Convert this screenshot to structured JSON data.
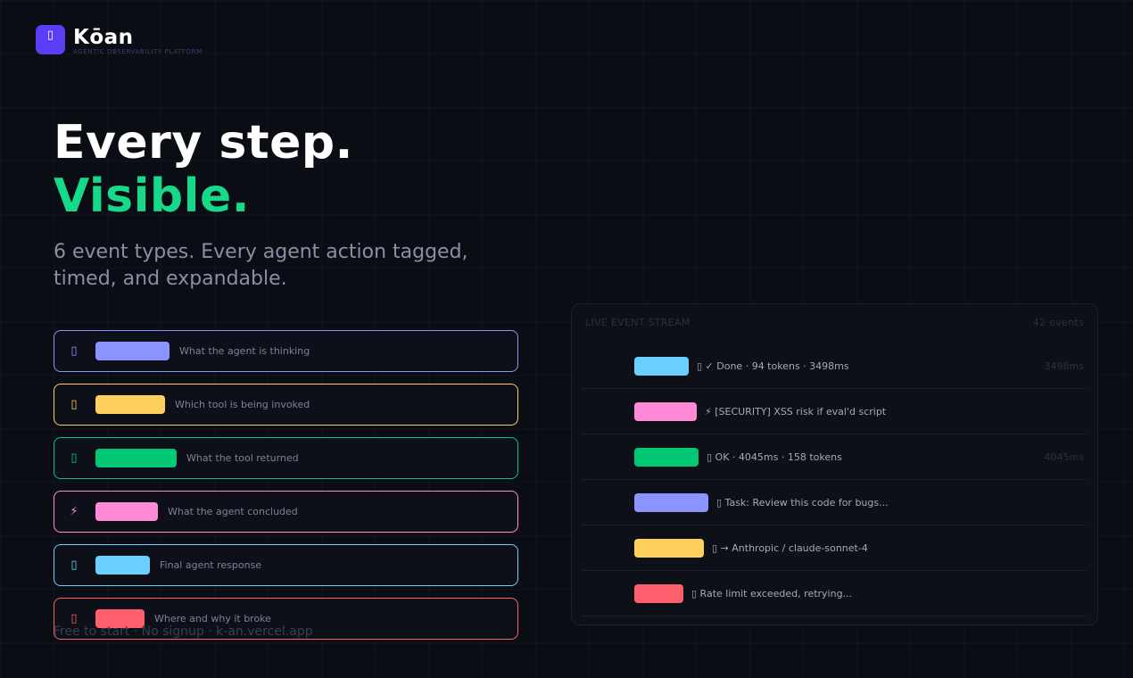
{
  "brand": {
    "name": "Kōan",
    "tagline": "AGENTIC OBSERVABILITY PLATFORM",
    "icon": "logo-icon",
    "color": "#5b3df5"
  },
  "hero": {
    "line1": "Every step.",
    "line2": "Visible.",
    "subtitle": "6 event types. Every agent action tagged, timed, and expandable."
  },
  "event_types": [
    {
      "icon": "thought-icon",
      "glyph": "▯",
      "color": "#8b93ff",
      "pill_width": 83,
      "description": "What the agent is thinking"
    },
    {
      "icon": "tool-icon",
      "glyph": "▯",
      "color": "#ffcf5c",
      "pill_width": 78,
      "description": "Which tool is being invoked"
    },
    {
      "icon": "result-icon",
      "glyph": "▯",
      "color": "#00c875",
      "pill_width": 91,
      "description": "What the tool returned"
    },
    {
      "icon": "lightning-icon",
      "glyph": "⚡",
      "color": "#ff8ad8",
      "pill_width": 70,
      "description": "What the agent concluded"
    },
    {
      "icon": "response-icon",
      "glyph": "▯",
      "color": "#6bcfff",
      "pill_width": 61,
      "description": "Final agent response"
    },
    {
      "icon": "error-icon",
      "glyph": "▯",
      "color": "#ff5f6d",
      "pill_width": 55,
      "description": "Where and why it broke"
    }
  ],
  "footer": {
    "note": "Free to start · No signup · k-an.vercel.app"
  },
  "stream": {
    "title": "LIVE EVENT STREAM",
    "count": "42 events",
    "events": [
      {
        "color": "#6bcfff",
        "pill_width": 61,
        "text": "▯ ✓ Done · 94 tokens · 3498ms",
        "time": "3498ms"
      },
      {
        "color": "#ff8ad8",
        "pill_width": 70,
        "text": "⚡ [SECURITY] XSS risk if eval'd script",
        "time": ""
      },
      {
        "color": "#00c875",
        "pill_width": 72,
        "text": "▯ OK · 4045ms · 158 tokens",
        "time": "4045ms"
      },
      {
        "color": "#8b93ff",
        "pill_width": 83,
        "text": "▯ Task: Review this code for bugs...",
        "time": ""
      },
      {
        "color": "#ffcf5c",
        "pill_width": 78,
        "text": "▯ → Anthropic / claude-sonnet-4",
        "time": ""
      },
      {
        "color": "#ff5f6d",
        "pill_width": 55,
        "text": "▯ Rate limit exceeded, retrying...",
        "time": ""
      }
    ]
  }
}
